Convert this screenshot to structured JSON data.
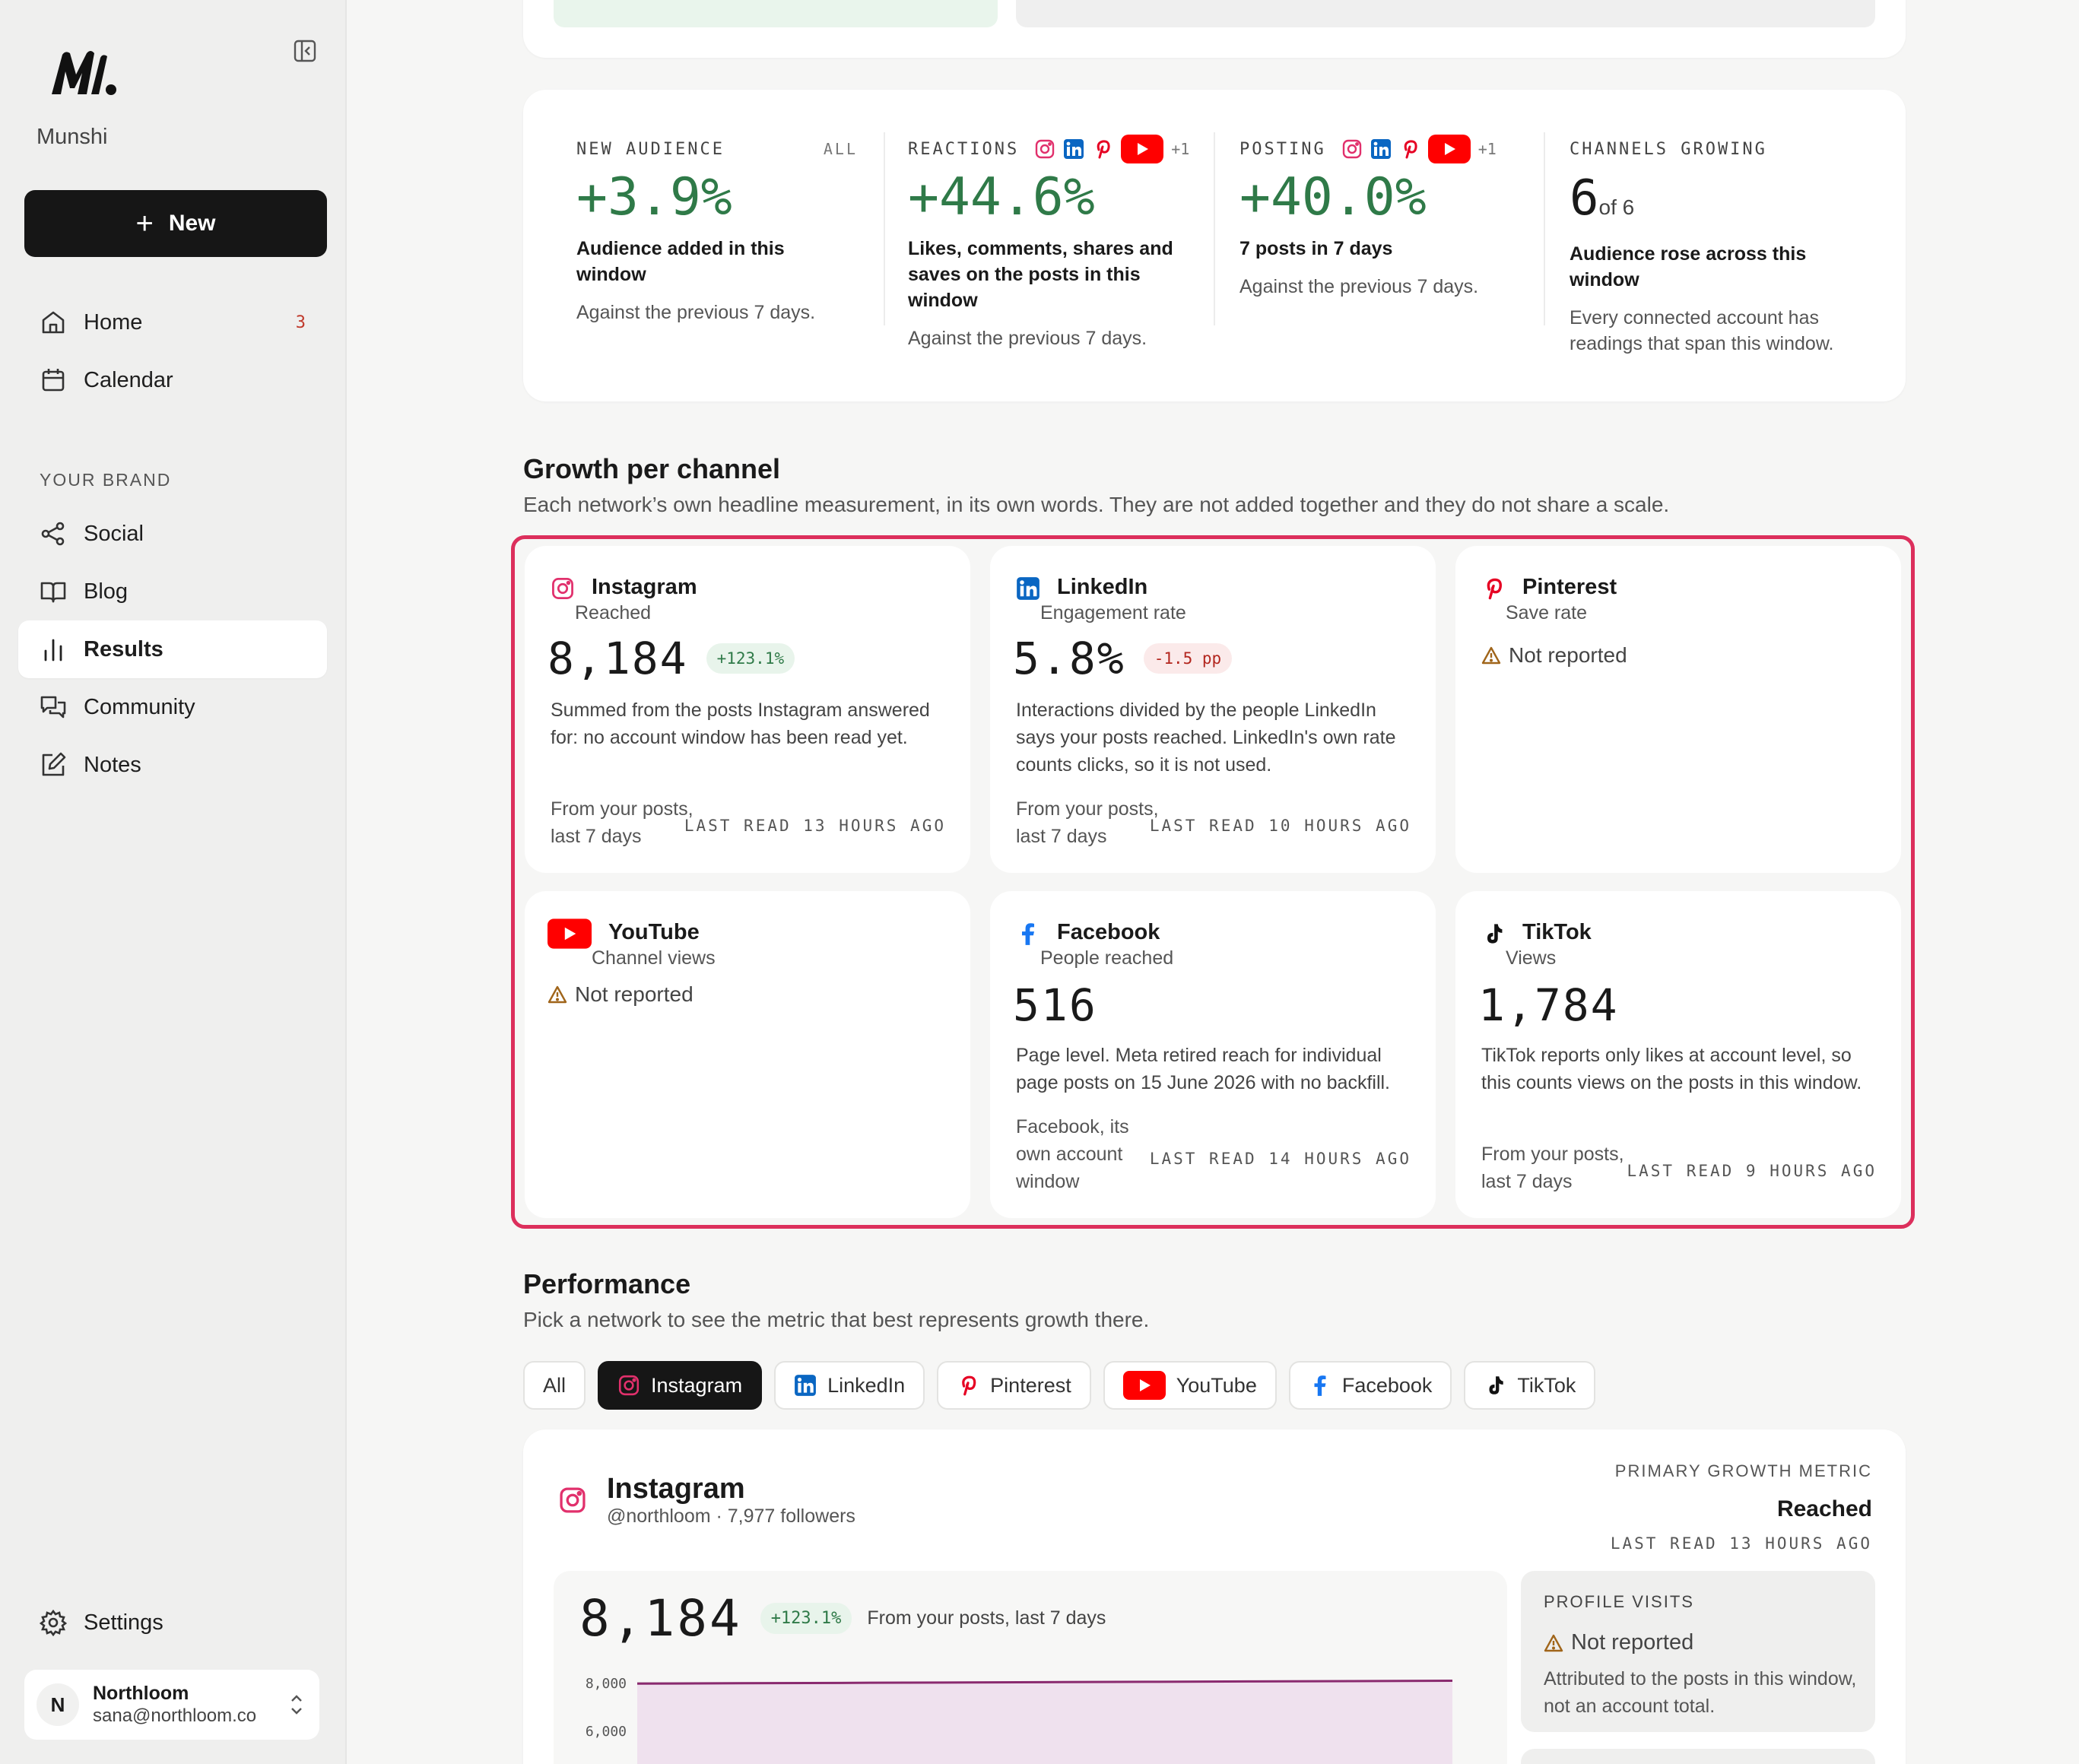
{
  "sidebar": {
    "brand": "Munshi",
    "new_label": "New",
    "nav_top": [
      {
        "label": "Home",
        "badge": "3"
      },
      {
        "label": "Calendar"
      }
    ],
    "section_label": "YOUR BRAND",
    "nav_brand": [
      {
        "label": "Social"
      },
      {
        "label": "Blog"
      },
      {
        "label": "Results"
      },
      {
        "label": "Community"
      },
      {
        "label": "Notes"
      }
    ],
    "active_item": "Results",
    "settings_label": "Settings",
    "user": {
      "initial": "N",
      "name": "Northloom",
      "email": "sana@northloom.co"
    }
  },
  "kpis": [
    {
      "label": "NEW AUDIENCE",
      "scope": "ALL",
      "value": "+3.9%",
      "headline": "Audience added in this window",
      "note": "Against the previous 7 days."
    },
    {
      "label": "REACTIONS",
      "extra": "+1",
      "value": "+44.6%",
      "headline": "Likes, comments, shares and saves on the posts in this window",
      "note": "Against the previous 7 days."
    },
    {
      "label": "POSTING",
      "extra": "+1",
      "value": "+40.0%",
      "headline": "7 posts in 7 days",
      "note": "Against the previous 7 days."
    },
    {
      "label": "CHANNELS GROWING",
      "value": "6",
      "value_sub": "of 6",
      "headline": "Audience rose across this window",
      "note": "Every connected account has readings that span this window."
    }
  ],
  "growth": {
    "title": "Growth per channel",
    "subtitle": "Each network’s own headline measurement, in its own words. They are not added together and they do not share a scale.",
    "not_reported": "Not reported",
    "channels": [
      {
        "name": "Instagram",
        "metric": "Reached",
        "value": "8,184",
        "delta": "+123.1%",
        "desc": "Summed from the posts Instagram answered for: no account window has been read yet.",
        "source": "From your posts, last 7 days",
        "read": "LAST READ 13 HOURS AGO"
      },
      {
        "name": "LinkedIn",
        "metric": "Engagement rate",
        "value": "5.8%",
        "delta": "-1.5 pp",
        "desc": "Interactions divided by the people LinkedIn says your posts reached. LinkedIn's own rate counts clicks, so it is not used.",
        "source": "From your posts, last 7 days",
        "read": "LAST READ 10 HOURS AGO"
      },
      {
        "name": "Pinterest",
        "metric": "Save rate"
      },
      {
        "name": "YouTube",
        "metric": "Channel views"
      },
      {
        "name": "Facebook",
        "metric": "People reached",
        "value": "516",
        "desc": "Page level. Meta retired reach for individual page posts on 15 June 2026 with no backfill.",
        "source": "Facebook, its own account window",
        "read": "LAST READ 14 HOURS AGO"
      },
      {
        "name": "TikTok",
        "metric": "Views",
        "value": "1,784",
        "desc": "TikTok reports only likes at account level, so this counts views on the posts in this window.",
        "source": "From your posts, last 7 days",
        "read": "LAST READ 9 HOURS AGO"
      }
    ]
  },
  "performance": {
    "title": "Performance",
    "subtitle": "Pick a network to see the metric that best represents growth there.",
    "tabs": [
      "All",
      "Instagram",
      "LinkedIn",
      "Pinterest",
      "YouTube",
      "Facebook",
      "TikTok"
    ],
    "active_tab": "Instagram",
    "account": {
      "name": "Instagram",
      "handle": "@northloom · 7,977 followers"
    },
    "primary_label": "PRIMARY GROWTH METRIC",
    "primary_value": "Reached",
    "primary_read": "LAST READ 13 HOURS AGO",
    "big_value": "8,184",
    "big_delta": "+123.1%",
    "big_source": "From your posts, last 7 days",
    "profile_visits": {
      "label": "PROFILE VISITS",
      "status": "Not reported",
      "desc": "Attributed to the posts in this window, not an account total."
    }
  },
  "chart_data": {
    "type": "area",
    "yticks": [
      "8,000",
      "6,000"
    ],
    "series": [
      {
        "values": [
          7960,
          7975,
          7990,
          8005,
          8020,
          8035,
          8050,
          8065,
          8080
        ]
      }
    ],
    "ylim": [
      5000,
      9000
    ],
    "grid": true,
    "colors": {
      "line": "#8a2a6f",
      "fill": "#efe1ee"
    }
  },
  "colors": {
    "accent_green": "#2f7a48",
    "highlight": "#dc2f5c",
    "instagram": "#e1306c",
    "linkedin": "#0a66c2",
    "pinterest": "#e60023",
    "youtube": "#ff0000",
    "facebook": "#1877f2"
  }
}
